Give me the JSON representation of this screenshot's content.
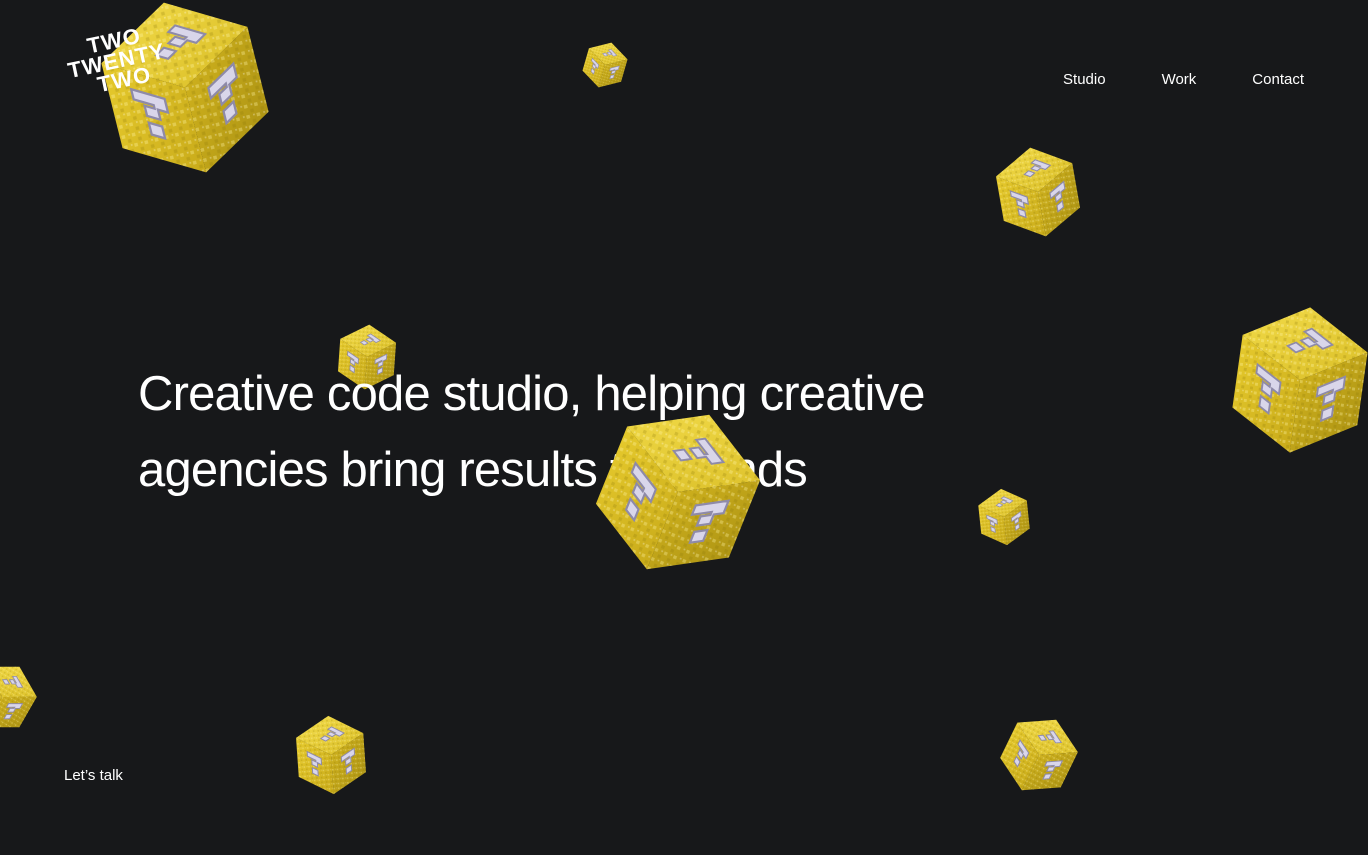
{
  "logo": {
    "line1": "TWO",
    "line2": "TWENTY",
    "line3": "TWO"
  },
  "nav": {
    "items": [
      {
        "label": "Studio"
      },
      {
        "label": "Work"
      },
      {
        "label": "Contact"
      }
    ]
  },
  "hero": {
    "line1": "Creative code studio, helping creative",
    "line2": "agencies bring results to brands"
  },
  "footer": {
    "lets_talk": "Let’s talk"
  },
  "colors": {
    "background": "#17181a",
    "text": "#ffffff",
    "cube_yellow": "#e2c52b",
    "cube_dark": "#b39a17",
    "question_mark": "#d9d6ea"
  },
  "decor": {
    "cube_icon": "question-block-icon"
  }
}
